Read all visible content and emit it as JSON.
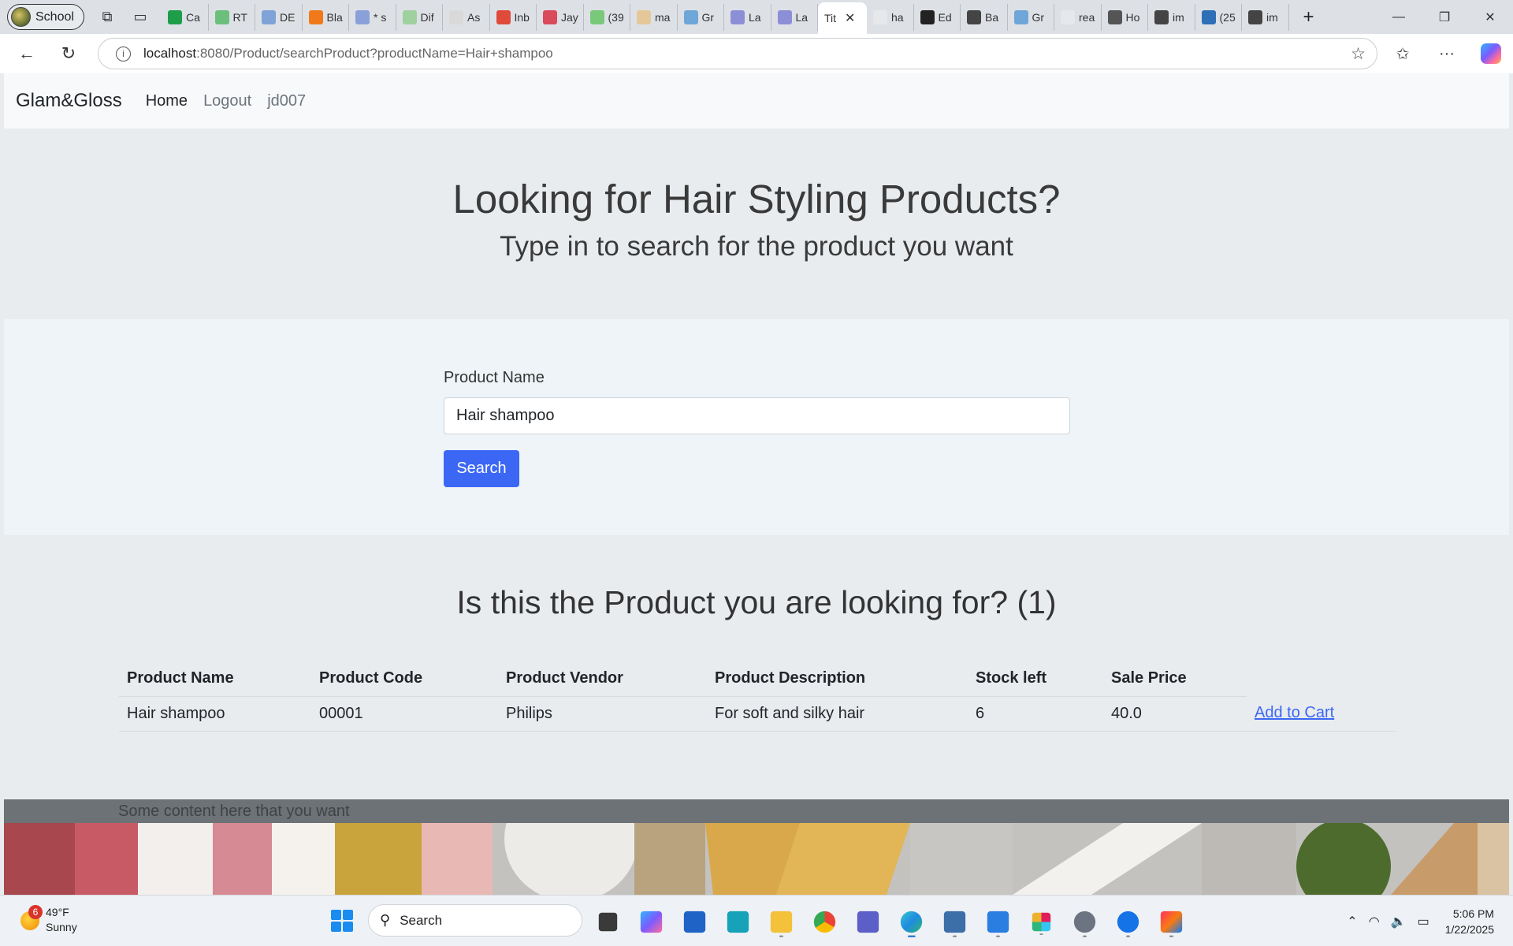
{
  "browser": {
    "profile_label": "School",
    "tabs": [
      {
        "label": "Ca",
        "color": "#1e9e4a"
      },
      {
        "label": "RT",
        "color": "#6cbf7b"
      },
      {
        "label": "DE",
        "color": "#7fa3d6"
      },
      {
        "label": "Bla",
        "color": "#f07a1a"
      },
      {
        "label": "* s",
        "color": "#8aa0d8"
      },
      {
        "label": "Dif",
        "color": "#9fd19f"
      },
      {
        "label": "As",
        "color": "#d9d9d9"
      },
      {
        "label": "Inb",
        "color": "#e04a3b"
      },
      {
        "label": "Jay",
        "color": "#d94a5a"
      },
      {
        "label": "(39",
        "color": "#7ac87a"
      },
      {
        "label": "ma",
        "color": "#e5c89a"
      },
      {
        "label": "Gr",
        "color": "#6fa6d8"
      },
      {
        "label": "La",
        "color": "#8d8fd6"
      },
      {
        "label": "La",
        "color": "#8d8fd6"
      },
      {
        "label": "Tit",
        "color": "#ffffff",
        "active": true
      },
      {
        "label": "ha",
        "color": "#e6e8eb"
      },
      {
        "label": "Ed",
        "color": "#222222"
      },
      {
        "label": "Ba",
        "color": "#444444"
      },
      {
        "label": "Gr",
        "color": "#6fa6d8"
      },
      {
        "label": "rea",
        "color": "#e6e8eb"
      },
      {
        "label": "Ho",
        "color": "#555555"
      },
      {
        "label": "im",
        "color": "#444444"
      },
      {
        "label": "(25",
        "color": "#2f6fb5"
      },
      {
        "label": "im",
        "color": "#444444"
      }
    ],
    "url_host": "localhost",
    "url_rest": ":8080/Product/searchProduct?productName=Hair+shampoo"
  },
  "site": {
    "brand": "Glam&Gloss",
    "nav": {
      "home": "Home",
      "logout": "Logout",
      "user": "jd007"
    }
  },
  "hero": {
    "title": "Looking for Hair Styling Products?",
    "subtitle": "Type in to search for the product you want"
  },
  "search": {
    "label": "Product Name",
    "value": "Hair shampoo",
    "button": "Search"
  },
  "results": {
    "title": "Is this the Product you are looking for? (1)",
    "headers": [
      "Product Name",
      "Product Code",
      "Product Vendor",
      "Product Description",
      "Stock left",
      "Sale Price"
    ],
    "rows": [
      {
        "name": "Hair shampoo",
        "code": "00001",
        "vendor": "Philips",
        "description": "For soft and silky hair",
        "stock": "6",
        "price": "40.0",
        "action": "Add to Cart"
      }
    ]
  },
  "footer": {
    "text": "Some content here that you want"
  },
  "taskbar": {
    "weather_temp": "49°F",
    "weather_desc": "Sunny",
    "weather_badge": "6",
    "search_label": "Search",
    "time": "5:06 PM",
    "date": "1/22/2025"
  }
}
